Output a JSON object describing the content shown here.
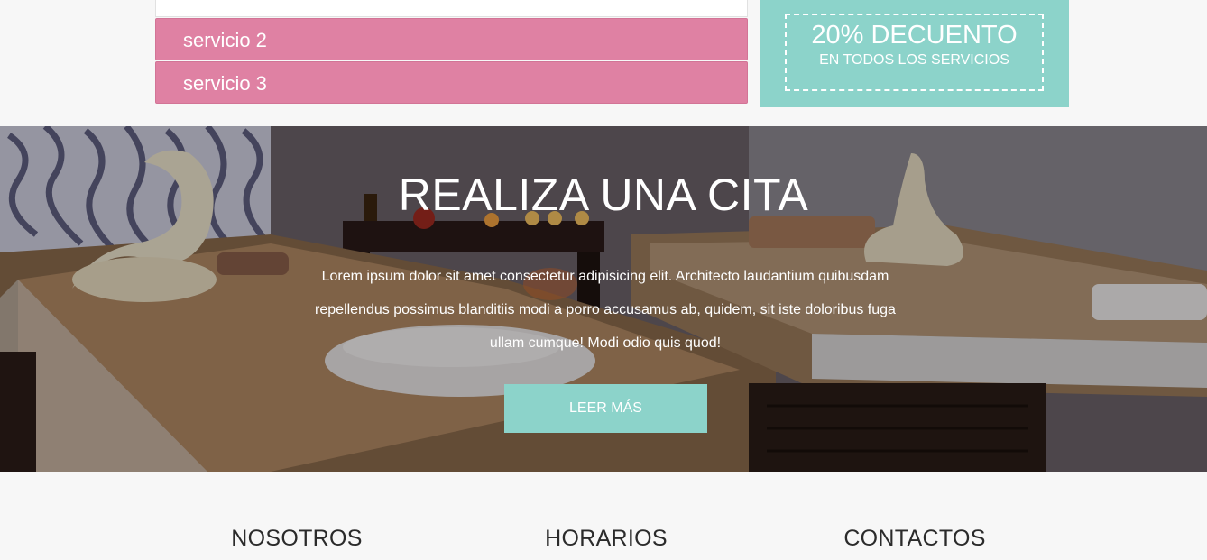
{
  "services": {
    "items": [
      {
        "label": "servicio 2"
      },
      {
        "label": "servicio 3"
      }
    ]
  },
  "discount": {
    "headline": "20% DECUENTO",
    "subline": "EN TODOS LOS SERVICIOS"
  },
  "hero": {
    "title": "REALIZA UNA CITA",
    "text": "Lorem ipsum dolor sit amet consectetur adipisicing elit. Architecto laudantium quibusdam repellendus possimus blanditiis modi a porro accusamus ab, quidem, sit iste doloribus fuga ullam cumque! Modi odio quis quod!",
    "button_label": "LEER MÁS"
  },
  "footer": {
    "headings": [
      "NOSOTROS",
      "HORARIOS",
      "CONTACTOS"
    ]
  },
  "colors": {
    "pink": "#df81a3",
    "teal": "#8cd3ca"
  }
}
